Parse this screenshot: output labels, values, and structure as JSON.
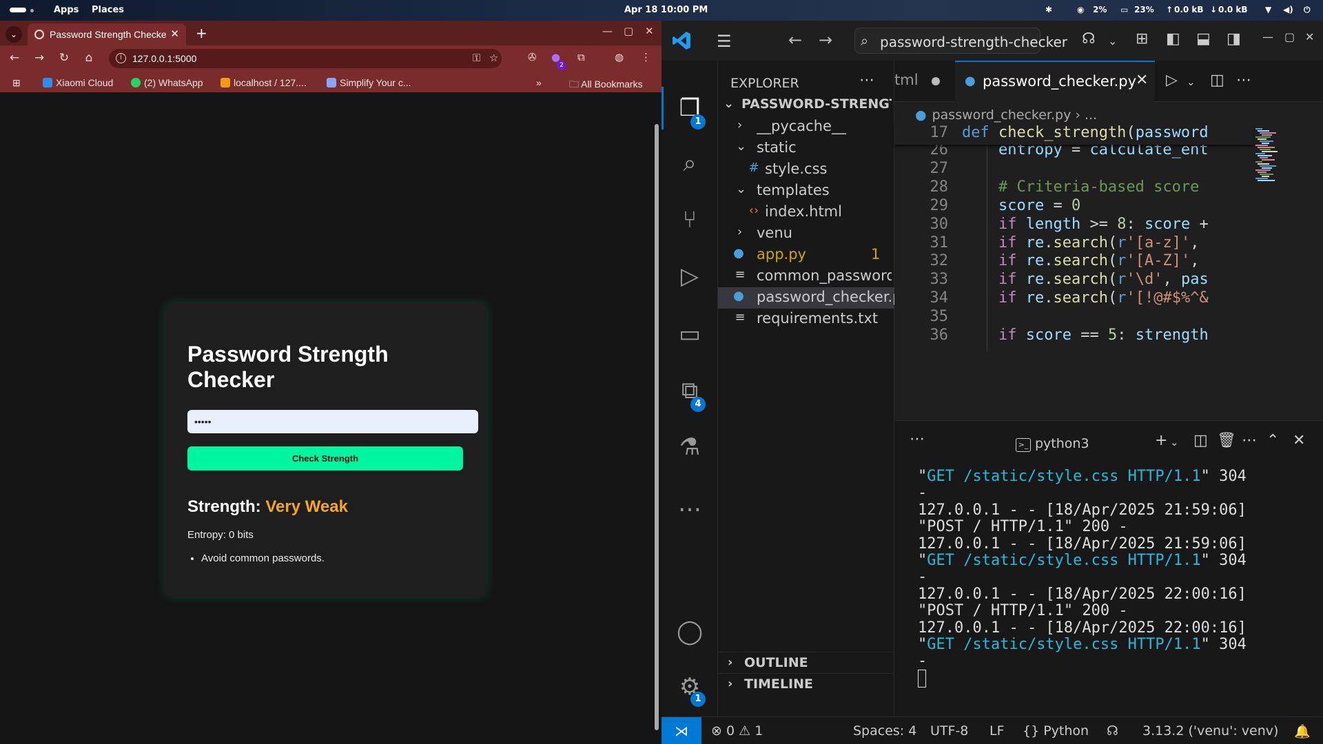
{
  "topbar": {
    "apps": "Apps",
    "places": "Places",
    "datetime": "Apr 18  10:00 PM",
    "cpu": "2%",
    "mem": "23%",
    "net_up": "0.0 kB",
    "net_down": "0.0 kB"
  },
  "chrome": {
    "tab_title": "Password Strength Checker",
    "url": "127.0.0.1:5000",
    "extension_badge": "2",
    "bookmarks": [
      "Xiaomi Cloud",
      "(2) WhatsApp",
      "localhost / 127....",
      "Simplify Your c..."
    ],
    "all_bookmarks": "All Bookmarks",
    "accent": "#7a2c2c"
  },
  "app": {
    "title": "Password Strength Checker",
    "password_value": "•••••",
    "check_button": "Check Strength",
    "strength_label": "Strength:",
    "strength_value": "Very Weak",
    "entropy": "Entropy: 0 bits",
    "tips": [
      "Avoid common passwords."
    ],
    "button_color": "#00f5a0",
    "strength_color": "#f5a623"
  },
  "vscode": {
    "command_center": "password-strength-checker",
    "explorer_title": "EXPLORER",
    "activity_badges": {
      "explorer": "1",
      "extensions": "4",
      "settings": "1"
    },
    "tree": [
      {
        "label": "PASSWORD-STRENGTH-C...",
        "kind": "root"
      },
      {
        "label": "__pycache__",
        "kind": "folder-closed"
      },
      {
        "label": "static",
        "kind": "folder-open"
      },
      {
        "label": "style.css",
        "kind": "css"
      },
      {
        "label": "templates",
        "kind": "folder-open"
      },
      {
        "label": "index.html",
        "kind": "html"
      },
      {
        "label": "venu",
        "kind": "folder-closed"
      },
      {
        "label": "app.py",
        "kind": "python-warn",
        "badge": "1"
      },
      {
        "label": "common_passwords...",
        "kind": "text"
      },
      {
        "label": "password_checker.py",
        "kind": "python-selected"
      },
      {
        "label": "requirements.txt",
        "kind": "text"
      }
    ],
    "outline": "OUTLINE",
    "timeline": "TIMELINE",
    "tabs": {
      "inactive": "tml",
      "active": "password_checker.py"
    },
    "breadcrumb": {
      "file": "password_checker.py",
      "rest": "› ..."
    },
    "code": [
      {
        "ln": "17",
        "text": "def check_strength(password"
      },
      {
        "ln": "26",
        "text": "    entropy = calculate_ent"
      },
      {
        "ln": "27",
        "text": ""
      },
      {
        "ln": "28",
        "text": "    # Criteria-based score"
      },
      {
        "ln": "29",
        "text": "    score = 0"
      },
      {
        "ln": "30",
        "text": "    if length >= 8: score +"
      },
      {
        "ln": "31",
        "text": "    if re.search(r'[a-z]', "
      },
      {
        "ln": "32",
        "text": "    if re.search(r'[A-Z]', "
      },
      {
        "ln": "33",
        "text": "    if re.search(r'\\d', pas"
      },
      {
        "ln": "34",
        "text": "    if re.search(r'[!@#$%^&"
      },
      {
        "ln": "35",
        "text": ""
      },
      {
        "ln": "36",
        "text": "    if score == 5: strength"
      }
    ],
    "terminal_name": "python3",
    "terminal": [
      {
        "q": "\"",
        "link": "GET /static/style.css HTTP/1.1",
        "rest": "\" 304"
      },
      {
        "plain": "-"
      },
      {
        "plain": "127.0.0.1 - - [18/Apr/2025 21:59:06]"
      },
      {
        "plain": "\"POST / HTTP/1.1\" 200 -"
      },
      {
        "plain": "127.0.0.1 - - [18/Apr/2025 21:59:06]"
      },
      {
        "q": "\"",
        "link": "GET /static/style.css HTTP/1.1",
        "rest": "\" 304"
      },
      {
        "plain": "-"
      },
      {
        "plain": "127.0.0.1 - - [18/Apr/2025 22:00:16]"
      },
      {
        "plain": "\"POST / HTTP/1.1\" 200 -"
      },
      {
        "plain": "127.0.0.1 - - [18/Apr/2025 22:00:16]"
      },
      {
        "q": "\"",
        "link": "GET /static/style.css HTTP/1.1",
        "rest": "\" 304"
      },
      {
        "plain": "-"
      }
    ],
    "status": {
      "errors": "0",
      "warnings": "1",
      "spaces": "Spaces: 4",
      "encoding": "UTF-8",
      "eol": "LF",
      "language": "Python",
      "interpreter": "3.13.2 ('venu': venv)"
    },
    "accent": "#0078d4"
  }
}
